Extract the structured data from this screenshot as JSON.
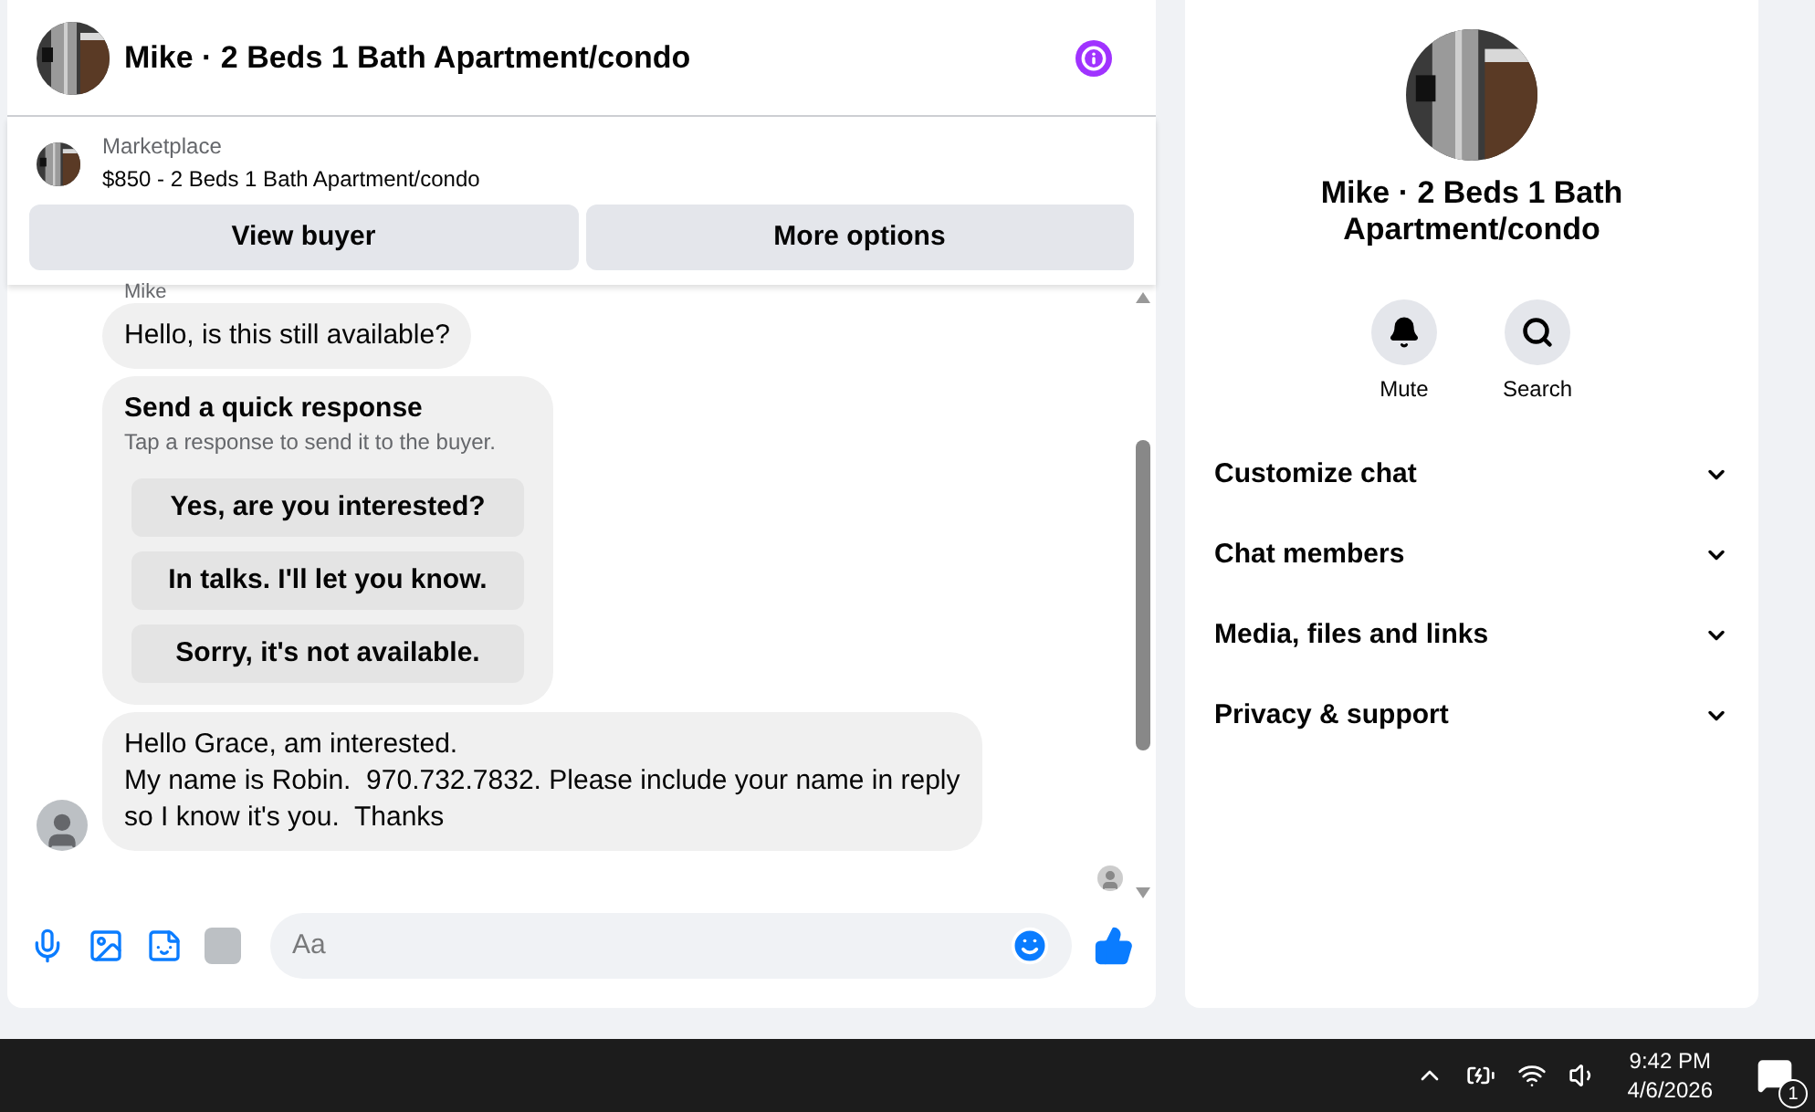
{
  "chat": {
    "title": "Mike · 2 Beds 1 Bath Apartment/condo",
    "listing": {
      "source": "Marketplace",
      "title": "$850 - 2 Beds 1 Bath Apartment/condo"
    },
    "actions": [
      "View buyer",
      "More options"
    ],
    "messages": [
      {
        "kind": "text",
        "sender": "Mike",
        "text": "Hello, is this still available?"
      },
      {
        "kind": "quick",
        "title": "Send a quick response",
        "hint": "Tap a response to send it to the buyer.",
        "options": [
          "Yes, are you interested?",
          "In talks. I'll let you know.",
          "Sorry, it's not available."
        ]
      },
      {
        "kind": "text",
        "avatar": true,
        "lines": [
          "Hello Grace, am interested.",
          "My name is Robin.  970.732.7832. Please include your name in reply",
          "so I know it's you.  Thanks"
        ]
      }
    ],
    "composer": {
      "placeholder": "Aa"
    }
  },
  "details": {
    "title": "Mike · 2 Beds 1 Bath Apartment/condo",
    "actions": [
      {
        "kind": "mute",
        "label": "Mute"
      },
      {
        "kind": "search",
        "label": "Search"
      }
    ],
    "sections": [
      {
        "label": "Customize chat",
        "expanded": false
      },
      {
        "label": "Chat members",
        "expanded": false
      },
      {
        "label": "Media, files and links",
        "expanded": false
      },
      {
        "label": "Privacy & support",
        "expanded": false
      }
    ]
  },
  "taskbar": {
    "time": "9:42 PM",
    "date": "4/6/2026",
    "notifications": "1"
  }
}
